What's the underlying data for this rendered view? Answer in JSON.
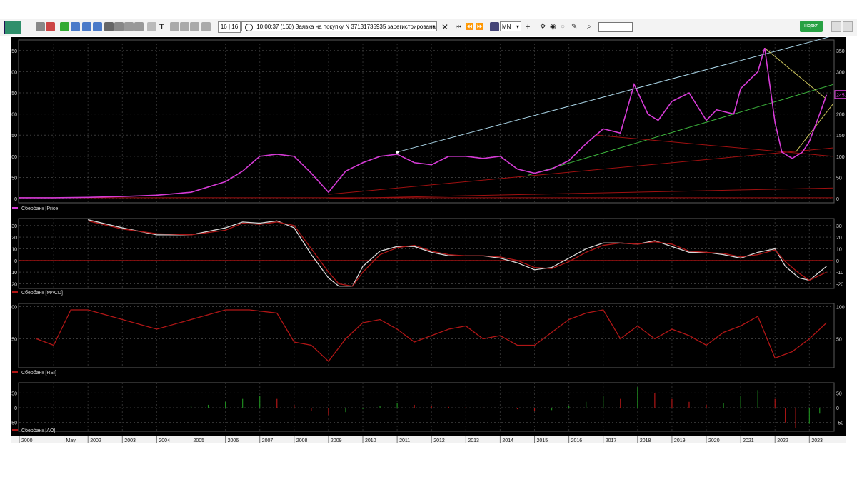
{
  "toolbar": {
    "pager": "16 | 16",
    "status_time": "10:00:37",
    "status_message": "(160) Заявка на покупку N 37131735935 зарегистрирована.",
    "timeframe": "MN",
    "text_tool": "T",
    "status_button": "Подкл",
    "icons": [
      "app-icon",
      "arrow-icon",
      "link-icon",
      "new-chart-icon",
      "window-icon",
      "window-icon",
      "table-icon",
      "search-window-icon",
      "print-icon",
      "layout-icon",
      "info-icon",
      "text-icon",
      "hand-icon",
      "hand-icon",
      "hand-icon",
      "hand-icon",
      "cross-icon",
      "first-icon",
      "prev-icon",
      "next-icon",
      "last-icon",
      "indicator-icon",
      "crosshair-icon",
      "move-icon",
      "target-icon",
      "circle-icon",
      "pencil-icon",
      "search-icon"
    ]
  },
  "colors": {
    "price": "#d63bd6",
    "macd_main": "#d9d9d9",
    "macd_signal": "#b01616",
    "rsi": "#b01616",
    "ao_up": "#1f8a1f",
    "ao_down": "#b01616",
    "channel_top": "#a9d4e6",
    "channel_green": "#3db53d",
    "fan_red": "#a01010",
    "yellow_line": "#c9c25a"
  },
  "chart_data": [
    {
      "type": "line",
      "legend": "Сбербанк [Price]",
      "last_value_label": "245.5",
      "yticks": [
        0,
        50,
        100,
        150,
        200,
        250,
        300,
        350
      ],
      "ylim": [
        -10,
        375
      ],
      "x": [
        2000,
        2001,
        2002,
        2003,
        2004,
        2005,
        2006,
        2006.5,
        2007,
        2007.5,
        2008,
        2008.5,
        2009,
        2009.5,
        2010,
        2010.5,
        2011,
        2011.5,
        2012,
        2012.5,
        2013,
        2013.5,
        2014,
        2014.5,
        2015,
        2015.5,
        2016,
        2016.5,
        2017,
        2017.5,
        2017.9,
        2018.3,
        2018.6,
        2019,
        2019.5,
        2020,
        2020.3,
        2020.8,
        2021,
        2021.5,
        2021.7,
        2022,
        2022.2,
        2022.5,
        2022.8,
        2023,
        2023.3,
        2023.5
      ],
      "y": [
        2,
        2,
        3,
        5,
        8,
        15,
        40,
        65,
        100,
        105,
        100,
        60,
        15,
        65,
        85,
        100,
        105,
        85,
        80,
        100,
        100,
        95,
        100,
        70,
        60,
        70,
        90,
        130,
        165,
        155,
        270,
        200,
        185,
        230,
        250,
        185,
        210,
        200,
        260,
        300,
        356,
        180,
        110,
        95,
        110,
        135,
        200,
        245.5
      ]
    },
    {
      "type": "line",
      "legend": "Сбербанк [MACD]",
      "yticks": [
        -20,
        -10,
        0,
        10,
        20,
        30
      ],
      "ylim": [
        -24,
        36
      ],
      "x": [
        2002,
        2003,
        2004,
        2005,
        2006,
        2006.5,
        2007,
        2007.5,
        2008,
        2008.5,
        2009,
        2009.3,
        2009.7,
        2010,
        2010.5,
        2011,
        2011.5,
        2012,
        2012.5,
        2013,
        2013.5,
        2014,
        2014.5,
        2015,
        2015.5,
        2016,
        2016.5,
        2017,
        2017.5,
        2018,
        2018.5,
        2019,
        2019.5,
        2020,
        2020.5,
        2021,
        2021.5,
        2022,
        2022.3,
        2022.7,
        2023,
        2023.5
      ],
      "series": [
        {
          "name": "MACD",
          "values": [
            35,
            28,
            22,
            22,
            28,
            33,
            32,
            34,
            28,
            5,
            -15,
            -22,
            -22,
            -5,
            8,
            12,
            12,
            7,
            4,
            4,
            4,
            2,
            -2,
            -8,
            -6,
            2,
            10,
            15,
            15,
            14,
            17,
            12,
            7,
            7,
            5,
            2,
            7,
            10,
            -5,
            -15,
            -17,
            -5
          ]
        },
        {
          "name": "Signal",
          "values": [
            34,
            27,
            23,
            22,
            26,
            32,
            31,
            33,
            30,
            10,
            -10,
            -20,
            -22,
            -10,
            5,
            11,
            13,
            8,
            5,
            4,
            4,
            3,
            0,
            -6,
            -7,
            -1,
            7,
            13,
            15,
            14,
            16,
            14,
            8,
            7,
            6,
            3,
            5,
            9,
            -1,
            -11,
            -17,
            -10
          ]
        }
      ]
    },
    {
      "type": "line",
      "legend": "Сбербанк [RSI]",
      "yticks": [
        50,
        100
      ],
      "ylim": [
        5,
        105
      ],
      "x": [
        2000.5,
        2001,
        2001.5,
        2002,
        2003,
        2004,
        2005,
        2006,
        2006.7,
        2007.5,
        2008,
        2008.5,
        2009,
        2009.5,
        2010,
        2010.5,
        2011,
        2011.5,
        2012,
        2012.5,
        2013,
        2013.5,
        2014,
        2014.5,
        2015,
        2015.5,
        2016,
        2016.5,
        2017,
        2017.5,
        2018,
        2018.5,
        2019,
        2019.5,
        2020,
        2020.5,
        2021,
        2021.5,
        2022,
        2022.5,
        2023,
        2023.5
      ],
      "values": [
        50,
        40,
        95,
        95,
        80,
        65,
        80,
        95,
        95,
        90,
        45,
        40,
        15,
        50,
        75,
        80,
        65,
        45,
        55,
        65,
        70,
        50,
        55,
        40,
        40,
        60,
        80,
        90,
        95,
        50,
        70,
        50,
        65,
        55,
        40,
        60,
        70,
        85,
        20,
        30,
        50,
        75
      ]
    },
    {
      "type": "bar",
      "legend": "Сбербанк [AO]",
      "yticks": [
        -50,
        0,
        50
      ],
      "ylim": [
        -80,
        85
      ],
      "x": [
        2005,
        2005.5,
        2006,
        2006.5,
        2007,
        2007.5,
        2008,
        2008.5,
        2009,
        2009.5,
        2010,
        2010.5,
        2011,
        2011.5,
        2012,
        2012.5,
        2013,
        2013.5,
        2014,
        2014.5,
        2015,
        2015.5,
        2016,
        2016.5,
        2017,
        2017.5,
        2018,
        2018.5,
        2019,
        2019.5,
        2020,
        2020.5,
        2021,
        2021.5,
        2022,
        2022.3,
        2022.6,
        2023,
        2023.3
      ],
      "values": [
        5,
        10,
        20,
        30,
        40,
        30,
        10,
        -10,
        -25,
        -15,
        -5,
        5,
        15,
        10,
        5,
        3,
        2,
        1,
        -2,
        -5,
        -10,
        -8,
        5,
        20,
        40,
        30,
        70,
        50,
        30,
        20,
        10,
        15,
        40,
        60,
        30,
        -50,
        -70,
        -55,
        -20
      ]
    }
  ],
  "x_axis": {
    "labels": [
      "2000",
      "May",
      "2002",
      "2003",
      "2004",
      "2005",
      "2006",
      "2007",
      "2008",
      "2009",
      "2010",
      "2011",
      "2012",
      "2013",
      "2014",
      "2015",
      "2016",
      "2017",
      "2018",
      "2019",
      "2020",
      "2021",
      "2022",
      "2023"
    ]
  }
}
